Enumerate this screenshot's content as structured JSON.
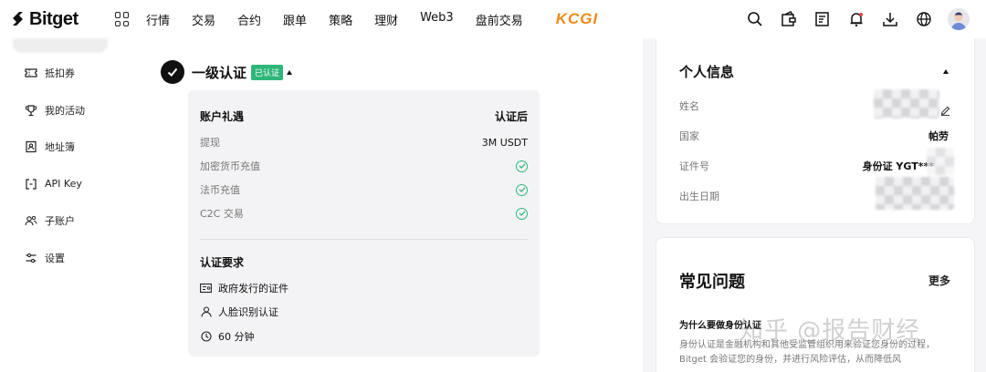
{
  "brand": {
    "logo_text": "Bitget",
    "partner": "KCGI"
  },
  "nav": {
    "items": [
      "行情",
      "交易",
      "合约",
      "跟单",
      "策略",
      "理财",
      "Web3",
      "盘前交易"
    ],
    "icons": [
      "search-icon",
      "wallet-icon",
      "orders-icon",
      "bell-icon",
      "download-icon",
      "globe-icon"
    ]
  },
  "sidebar": {
    "items": [
      {
        "label": "抵扣券",
        "icon": "coupon-icon"
      },
      {
        "label": "我的活动",
        "icon": "trophy-icon"
      },
      {
        "label": "地址簿",
        "icon": "address-book-icon"
      },
      {
        "label": "API Key",
        "icon": "api-key-icon"
      },
      {
        "label": "子账户",
        "icon": "sub-account-icon"
      },
      {
        "label": "设置",
        "icon": "settings-icon"
      }
    ]
  },
  "verification": {
    "title": "一级认证",
    "badge": "已认证",
    "benefits_header": "账户礼遇",
    "after_header": "认证后",
    "rows": [
      {
        "label": "提现",
        "value": "3M USDT"
      },
      {
        "label": "加密货币充值",
        "value": ""
      },
      {
        "label": "法币充值",
        "value": ""
      },
      {
        "label": "C2C 交易",
        "value": ""
      }
    ],
    "requirements_header": "认证要求",
    "requirements": [
      {
        "label": "政府发行的证件",
        "icon": "id-card-icon"
      },
      {
        "label": "人脸识别认证",
        "icon": "person-icon"
      },
      {
        "label": "60 分钟",
        "icon": "clock-icon"
      }
    ]
  },
  "personal_info": {
    "title": "个人信息",
    "fields": [
      {
        "label": "姓名",
        "value": ""
      },
      {
        "label": "国家",
        "value": "帕劳"
      },
      {
        "label": "证件号",
        "value": "身份证 YGT***"
      },
      {
        "label": "出生日期",
        "value": ""
      }
    ]
  },
  "faq": {
    "title": "常见问题",
    "more": "更多",
    "question": "为什么要做身份认证",
    "answer": "身份认证是金融机构和其他受监管组织用来验证您身份的过程，Bitget 会验证您的身份，并进行风险评估，从而降低风"
  },
  "watermark": "知乎 @报告财经",
  "colors": {
    "accent_green": "#2fb67a",
    "kcgi_orange": "#f08a1c"
  }
}
